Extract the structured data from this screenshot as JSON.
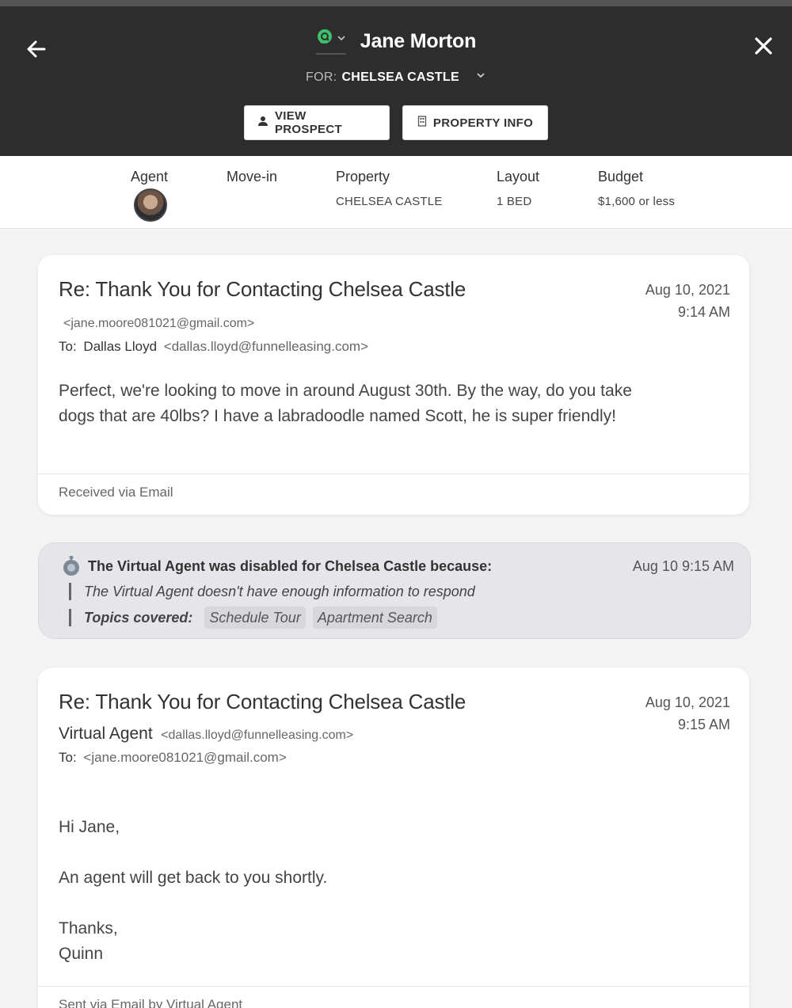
{
  "header": {
    "name": "Jane Morton",
    "for_label": "FOR:",
    "for_value": "CHELSEA CASTLE",
    "view_prospect_label": "VIEW PROSPECT",
    "property_info_label": "PROPERTY INFO",
    "channel_color": "#3ec26b"
  },
  "summary": {
    "agent_label": "Agent",
    "movein_label": "Move-in",
    "property_label": "Property",
    "property_value": "CHELSEA CASTLE",
    "layout_label": "Layout",
    "layout_value": "1 BED",
    "budget_label": "Budget",
    "budget_value": "$1,600 or less"
  },
  "message1": {
    "subject": "Re: Thank You for Contacting Chelsea Castle",
    "date": "Aug 10, 2021",
    "time": "9:14 AM",
    "from_email": "<jane.moore081021@gmail.com>",
    "to_label": "To:",
    "to_name": "Dallas Lloyd",
    "to_email": "<dallas.lloyd@funnelleasing.com>",
    "body": "Perfect, we're looking to move in around August 30th. By the way, do you take dogs that are 40lbs? I have a labradoodle named Scott, he is super friendly!",
    "footer": "Received via Email"
  },
  "notice": {
    "title": "The Virtual Agent was disabled for Chelsea Castle because:",
    "time": "Aug 10 9:15 AM",
    "reason": "The Virtual Agent doesn't have enough information to respond",
    "topics_label": "Topics covered:",
    "topics": [
      "Schedule Tour",
      "Apartment Search"
    ]
  },
  "message2": {
    "subject": "Re: Thank You for Contacting Chelsea Castle",
    "date": "Aug 10, 2021",
    "time": "9:15 AM",
    "sender": "Virtual Agent",
    "from_email": "<dallas.lloyd@funnelleasing.com>",
    "to_label": "To:",
    "to_email": "<jane.moore081021@gmail.com>",
    "greeting": "Hi Jane,",
    "line1": "An agent will get back to you shortly.",
    "signoff": "Thanks,",
    "signature": "Quinn",
    "footer": "Sent via Email by Virtual Agent"
  }
}
